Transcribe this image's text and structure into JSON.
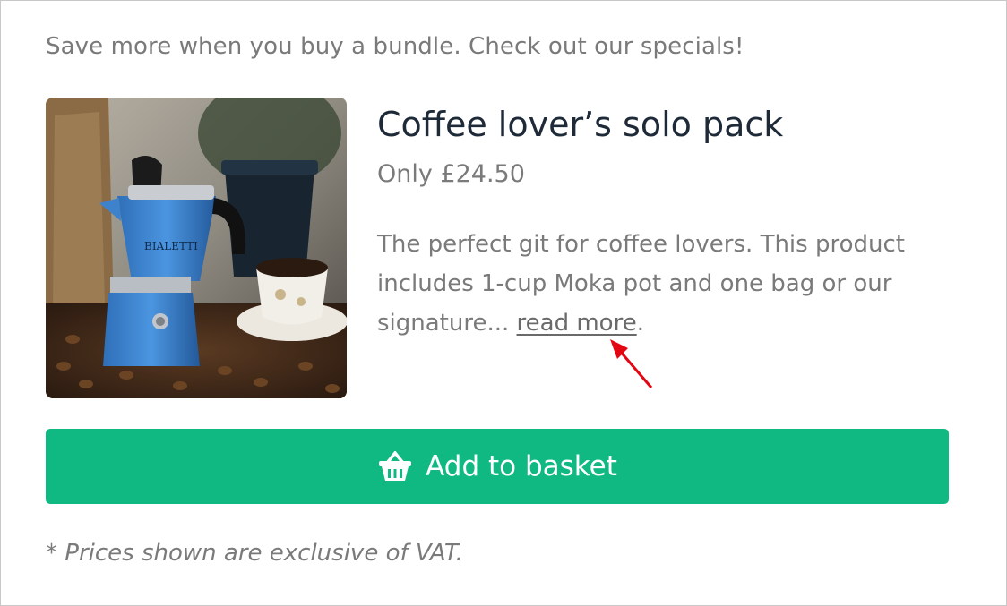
{
  "promo": {
    "text": "Save more when you buy a bundle. Check out our specials!"
  },
  "product": {
    "image_alt": "Blue Moka pot with coffee cup and beans",
    "title": "Coffee lover’s solo pack",
    "price": "Only £24.50",
    "description": "The perfect git for coffee lovers. This product includes 1-cup Moka pot and one bag or our signature... ",
    "read_more": "read more",
    "read_more_suffix": "."
  },
  "basket_button": {
    "label": "Add to basket",
    "icon": "basket-icon"
  },
  "footnote": {
    "text": "* Prices shown are exclusive of VAT."
  },
  "colors": {
    "accent": "#10b981",
    "text_muted": "#7a7a7a",
    "title": "#1e2a38",
    "annotation": "#e30613"
  }
}
